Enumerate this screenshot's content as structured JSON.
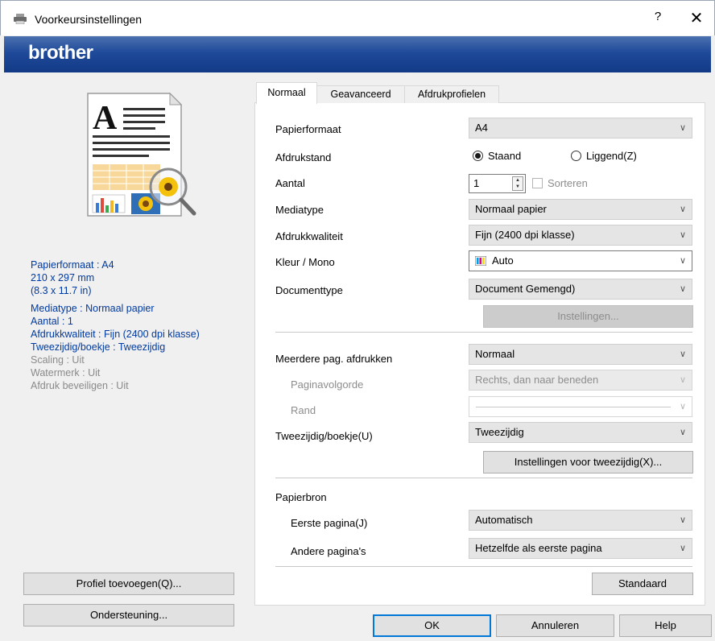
{
  "window": {
    "title": "Voorkeursinstellingen",
    "help": "?",
    "close": "✕"
  },
  "banner": {
    "logo": "brother"
  },
  "summary": {
    "paper_size": "Papierformaat : A4",
    "dimensions_mm": "210 x 297 mm",
    "dimensions_in": "(8.3 x 11.7 in)",
    "media_type": "Mediatype : Normaal papier",
    "copies": "Aantal : 1",
    "quality": "Afdrukkwaliteit : Fijn (2400 dpi klasse)",
    "duplex": "Tweezijdig/boekje : Tweezijdig",
    "scaling": "Scaling : Uit",
    "watermark": "Watermerk : Uit",
    "secure_print": "Afdruk beveiligen : Uit"
  },
  "left_buttons": {
    "add_profile": "Profiel toevoegen(Q)...",
    "support": "Ondersteuning..."
  },
  "tabs": [
    "Normaal",
    "Geavanceerd",
    "Afdrukprofielen"
  ],
  "form": {
    "paper_size": {
      "label": "Papierformaat",
      "value": "A4"
    },
    "orientation": {
      "label": "Afdrukstand",
      "portrait": "Staand",
      "landscape": "Liggend(Z)",
      "selected": "Staand"
    },
    "copies": {
      "label": "Aantal",
      "value": "1",
      "collate": "Sorteren",
      "collate_checked": false
    },
    "media_type": {
      "label": "Mediatype",
      "value": "Normaal papier"
    },
    "print_quality": {
      "label": "Afdrukkwaliteit",
      "value": "Fijn (2400 dpi klasse)"
    },
    "color_mono": {
      "label": "Kleur / Mono",
      "value": "Auto"
    },
    "document_type": {
      "label": "Documenttype",
      "value": "Document Gemengd)"
    },
    "settings_button": "Instellingen...",
    "multiple_page": {
      "label": "Meerdere pag. afdrukken",
      "value": "Normaal"
    },
    "page_order": {
      "label": "Paginavolgorde",
      "value": "Rechts, dan naar beneden"
    },
    "border": {
      "label": "Rand",
      "value": ""
    },
    "duplex": {
      "label": "Tweezijdig/boekje(U)",
      "value": "Tweezijdig"
    },
    "duplex_settings_button": "Instellingen voor tweezijdig(X)...",
    "paper_source": {
      "label": "Papierbron"
    },
    "first_page": {
      "label": "Eerste pagina(J)",
      "value": "Automatisch"
    },
    "other_pages": {
      "label": "Andere pagina's",
      "value": "Hetzelfde als eerste pagina"
    },
    "default_button": "Standaard"
  },
  "footer": {
    "ok": "OK",
    "cancel": "Annuleren",
    "help": "Help"
  },
  "colors": {
    "banner": "#1f4a9a",
    "summary_text": "#003aa0",
    "accent": "#0078d7"
  }
}
